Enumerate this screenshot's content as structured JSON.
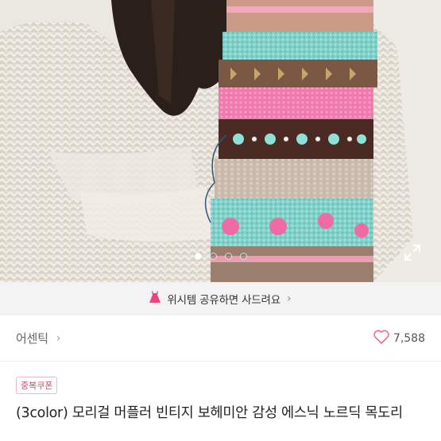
{
  "gallery": {
    "total_images": 4,
    "active_index": 0,
    "expand_icon": "expand-icon"
  },
  "wish_banner": {
    "text": "위시템 공유하면 사드려요",
    "icon": "dress-icon",
    "icon_color": "#f0457c"
  },
  "shop": {
    "name": "어센틱",
    "chevron": "›",
    "like_count": "7,588",
    "heart_icon": "heart-outline-icon",
    "heart_color": "#f06d84"
  },
  "product": {
    "coupon_badge": "중복쿠폰",
    "title": "(3color) 모리걸 머플러 빈티지 보헤미안 감성 에스닉 노르딕 목도리"
  }
}
